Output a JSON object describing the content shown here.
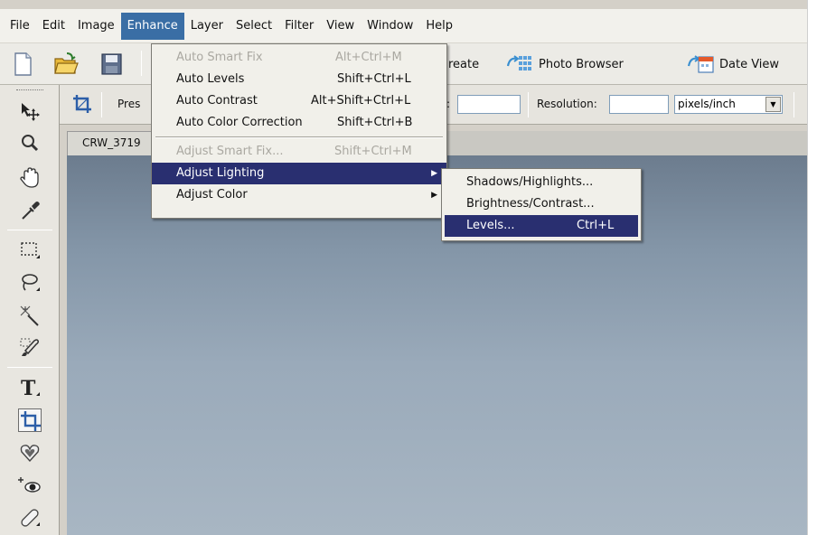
{
  "menubar": {
    "items": [
      "File",
      "Edit",
      "Image",
      "Enhance",
      "Layer",
      "Select",
      "Filter",
      "View",
      "Window",
      "Help"
    ],
    "active": "Enhance"
  },
  "shortcuts": {
    "create_label": "reate",
    "photo_browser_label": "Photo Browser",
    "date_view_label": "Date View"
  },
  "options": {
    "preset_label": "Pres",
    "colon": ":",
    "resolution_label": "Resolution:",
    "resolution_value": "",
    "units_value": "pixels/inch"
  },
  "document": {
    "tab_title": "CRW_3719"
  },
  "enhance_menu": {
    "auto_smart_fix": {
      "label": "Auto Smart Fix",
      "shortcut": "Alt+Ctrl+M"
    },
    "auto_levels": {
      "label": "Auto Levels",
      "shortcut": "Shift+Ctrl+L"
    },
    "auto_contrast": {
      "label": "Auto Contrast",
      "shortcut": "Alt+Shift+Ctrl+L"
    },
    "auto_color": {
      "label": "Auto Color Correction",
      "shortcut": "Shift+Ctrl+B"
    },
    "adjust_smart_fix": {
      "label": "Adjust Smart Fix...",
      "shortcut": "Shift+Ctrl+M"
    },
    "adjust_lighting": {
      "label": "Adjust Lighting"
    },
    "adjust_color": {
      "label": "Adjust Color"
    }
  },
  "lighting_submenu": {
    "shadows": {
      "label": "Shadows/Highlights..."
    },
    "brightness": {
      "label": "Brightness/Contrast..."
    },
    "levels": {
      "label": "Levels...",
      "shortcut": "Ctrl+L"
    }
  },
  "tools": [
    "move",
    "zoom",
    "hand",
    "eyedropper",
    "marquee",
    "lasso",
    "magic-wand",
    "selection-brush",
    "type",
    "crop",
    "cookie-cutter",
    "red-eye",
    "healing-brush"
  ],
  "colors": {
    "menu_highlight": "#292f70",
    "menubar_active": "#3a6ea5",
    "canvas_top": "#6c7c8e",
    "canvas_bottom": "#a8b6c3"
  }
}
